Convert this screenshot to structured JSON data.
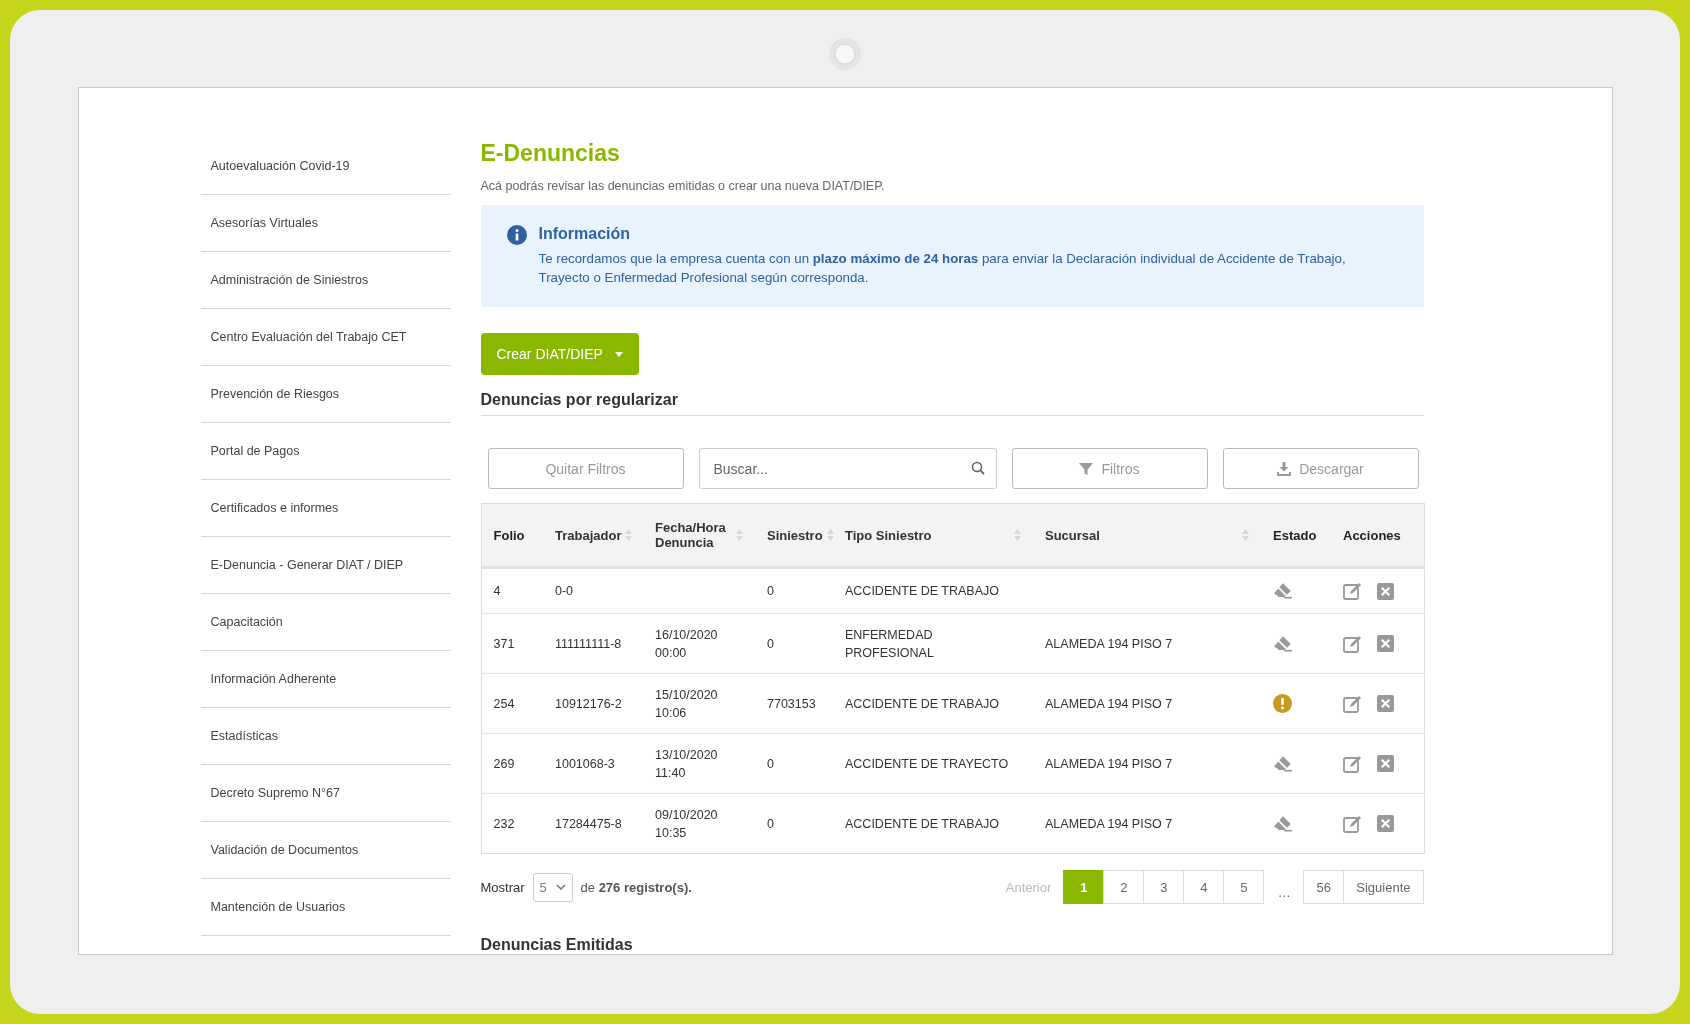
{
  "sidebar": {
    "items": [
      {
        "label": "Autoevaluación Covid-19"
      },
      {
        "label": "Asesorías Virtuales"
      },
      {
        "label": "Administración de Siniestros"
      },
      {
        "label": "Centro Evaluación del Trabajo CET"
      },
      {
        "label": "Prevención de Riesgos"
      },
      {
        "label": "Portal de Pagos"
      },
      {
        "label": "Certificados e informes"
      },
      {
        "label": "E-Denuncia - Generar DIAT / DIEP"
      },
      {
        "label": "Capacitación"
      },
      {
        "label": "Información Adherente"
      },
      {
        "label": "Estadísticas"
      },
      {
        "label": "Decreto Supremo N°67"
      },
      {
        "label": "Validación de Documentos"
      },
      {
        "label": "Mantención de Usuarios"
      }
    ]
  },
  "page": {
    "title": "E-Denuncias",
    "subtitle": "Acá podrás revisar las denuncias emitidas o crear una nueva DIAT/DIEP."
  },
  "info": {
    "title": "Información",
    "text": "Te recordamos que la empresa cuenta con un **plazo máximo de 24 horas** para enviar la Declaración individual de Accidente de Trabajo, Trayecto o Enfermedad Profesional según corresponda."
  },
  "create_button": {
    "label": "Crear DIAT/DIEP"
  },
  "section_title": "Denuncias por regularizar",
  "toolbar": {
    "clear_filters": "Quitar Filtros",
    "search": {
      "placeholder": "Buscar..."
    },
    "filters": "Filtros",
    "download": "Descargar"
  },
  "table": {
    "columns": [
      {
        "label": "Folio",
        "sortable": false
      },
      {
        "label": "Trabajador",
        "sortable": true
      },
      {
        "label": "Fecha/Hora Denuncia",
        "sortable": true
      },
      {
        "label": "Siniestro",
        "sortable": true
      },
      {
        "label": "Tipo Siniestro",
        "sortable": true
      },
      {
        "label": "Sucursal",
        "sortable": true
      },
      {
        "label": "Estado",
        "sortable": false
      },
      {
        "label": "Acciones",
        "sortable": false
      }
    ],
    "rows": [
      {
        "folio": "4",
        "worker": "0-0",
        "date": "",
        "claim": "0",
        "type": "ACCIDENTE DE TRABAJO",
        "branch": "",
        "kind": "eraser"
      },
      {
        "folio": "371",
        "worker": "111111111-8",
        "date": "16/10/2020 00:00",
        "claim": "0",
        "type": "ENFERMEDAD PROFESIONAL",
        "branch": "ALAMEDA 194 PISO 7",
        "kind": "eraser"
      },
      {
        "folio": "254",
        "worker": "10912176-2",
        "date": "15/10/2020 10:06",
        "claim": "7703153",
        "type": "ACCIDENTE DE TRABAJO",
        "branch": "ALAMEDA 194 PISO 7",
        "kind": "warning"
      },
      {
        "folio": "269",
        "worker": "1001068-3",
        "date": "13/10/2020 11:40",
        "claim": "0",
        "type": "ACCIDENTE DE TRAYECTO",
        "branch": "ALAMEDA 194 PISO 7",
        "kind": "eraser"
      },
      {
        "folio": "232",
        "worker": "17284475-8",
        "date": "09/10/2020 10:35",
        "claim": "0",
        "type": "ACCIDENTE DE TRABAJO",
        "branch": "ALAMEDA 194 PISO 7",
        "kind": "eraser"
      }
    ]
  },
  "footer": {
    "show_label": "Mostrar",
    "page_size": "5",
    "records": "de **276 registro(s).**"
  },
  "pagination": {
    "previous": {
      "label": "Anterior",
      "disabled": true
    },
    "next": {
      "label": "Siguiente",
      "disabled": false
    },
    "pages": [
      {
        "label": "1",
        "selected": true
      },
      {
        "label": "2",
        "selected": false
      },
      {
        "label": "3",
        "selected": false
      },
      {
        "label": "4",
        "selected": false
      },
      {
        "label": "5",
        "selected": false
      },
      {
        "label": "…",
        "kind": "ellipsis"
      },
      {
        "label": "56",
        "selected": false
      }
    ]
  },
  "next_section_title": "Denuncias Emitidas"
}
